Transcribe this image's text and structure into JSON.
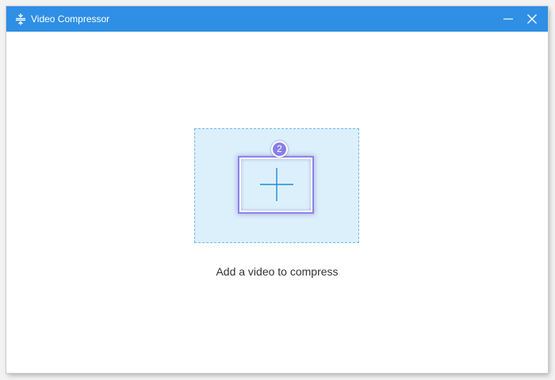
{
  "window": {
    "title": "Video Compressor",
    "app_icon": "compress-icon",
    "controls": {
      "minimize_icon": "minimize-icon",
      "close_icon": "close-icon"
    }
  },
  "main": {
    "drop_zone": {
      "icon": "plus-icon",
      "step_badge": "2"
    },
    "prompt": "Add a video to compress"
  },
  "colors": {
    "titlebar": "#2e8fe5",
    "drop_zone_bg": "#dcf0fc",
    "drop_zone_border": "#72b6e8",
    "accent_purple": "#8a7fe6",
    "plus": "#1f8ad8"
  }
}
